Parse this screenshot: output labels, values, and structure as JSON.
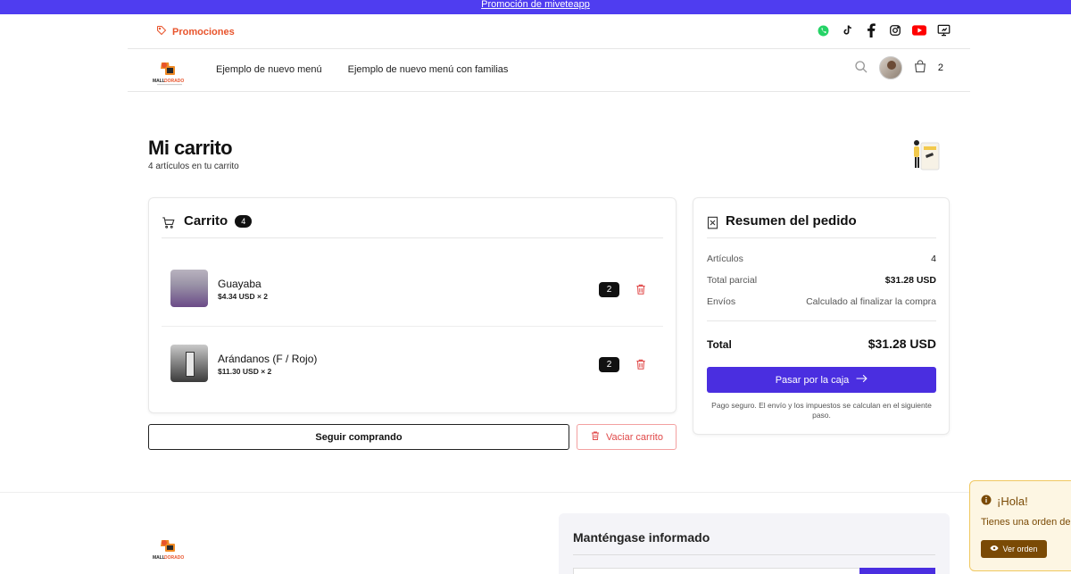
{
  "promo_bar": {
    "text": "Promoción de miveteapp"
  },
  "topbar": {
    "promotions_label": "Promociones",
    "social_icons": [
      "whatsapp-icon",
      "tiktok-icon",
      "facebook-icon",
      "instagram-icon",
      "youtube-icon",
      "monitor-icon"
    ]
  },
  "brand": {
    "logo_line1": "MALL DORADO"
  },
  "nav": {
    "links": [
      "Ejemplo de nuevo menú",
      "Ejemplo de nuevo menú con familias"
    ],
    "cart_count": "2"
  },
  "page": {
    "title": "Mi carrito",
    "subtitle": "4 artículos en tu carrito"
  },
  "cart": {
    "title": "Carrito",
    "badge": "4",
    "items": [
      {
        "name": "Guayaba",
        "price": "$4.34 USD × 2",
        "qty": "2"
      },
      {
        "name": "Arándanos (F / Rojo)",
        "price": "$11.30 USD × 2",
        "qty": "2"
      }
    ],
    "continue_label": "Seguir comprando",
    "empty_label": "Vaciar carrito"
  },
  "summary": {
    "title": "Resumen del pedido",
    "rows": [
      {
        "label": "Artículos",
        "value": "4"
      },
      {
        "label": "Total parcial",
        "value": "$31.28 USD"
      },
      {
        "label": "Envíos",
        "value": "Calculado al finalizar la compra"
      }
    ],
    "total_label": "Total",
    "total_value": "$31.28 USD",
    "checkout_label": "Pasar por la caja",
    "secure_note": "Pago seguro. El envío y los impuestos se calculan en el siguiente paso."
  },
  "footer": {
    "newsletter_title": "Manténgase informado"
  },
  "toast": {
    "title": "¡Hola!",
    "message": "Tienes una orden de",
    "button": "Ver orden"
  },
  "colors": {
    "accent": "#4a2ee0",
    "promo_bar": "#4f3df0",
    "promo_text": "#e8542c",
    "danger": "#e04848",
    "toast_bg": "#fdf6e3"
  }
}
